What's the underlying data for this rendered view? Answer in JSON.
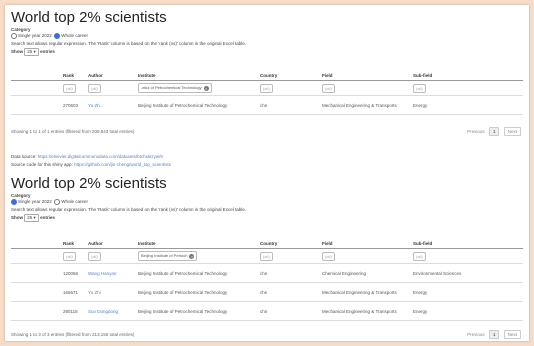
{
  "sec1": {
    "title": "World top 2% scientists",
    "category_label": "Category",
    "options": [
      "Single year 2022",
      "Whole career"
    ],
    "note": "Search text allows regular expression. The 'Rank' column is based on the 'rank (ns)' column in the original Excel table.",
    "show_label": "Show",
    "show_value": "25",
    "entries_label": "entries",
    "headers": [
      "Rank",
      "Author",
      "Institute",
      "Country",
      "Field",
      "Sub-field"
    ],
    "filters": [
      "(all)",
      "(all)",
      "-ekiz of Petrochemical Technology",
      "(all)",
      "(all)",
      "(all)"
    ],
    "rows": [
      {
        "rank": "270603",
        "author": "Yu Zh...",
        "institute": "Beijing Institute of Petrochemical Technology",
        "country": "chn",
        "field": "Mechanical Engineering & Transports",
        "subfield": "Energy"
      }
    ],
    "info": "Showing 1 to 1 of 1 entries (filtered from 209,843 total entries)",
    "prev": "Previous",
    "page": "1",
    "next": "Next"
  },
  "sources": {
    "data_label": "Data source:",
    "data_url": "https://elsevier.digitalcommonsdata.com/datasets/btchxktzyw/6",
    "code_label": "Source code for this shiny app:",
    "code_url": "https://github.com/jin-cheng/world_top_scientists"
  },
  "sec2": {
    "title": "World top 2% scientists",
    "category_label": "Category",
    "options": [
      "Single year 2022",
      "Whole career"
    ],
    "note": "Search text allows regular expression. The 'Rank' column is based on the 'rank (ns)' column in the original Excel table.",
    "show_label": "Show",
    "show_value": "25",
    "entries_label": "entries",
    "headers": [
      "Rank",
      "Author",
      "Institute",
      "Country",
      "Field",
      "Sub-field"
    ],
    "filters": [
      "(all)",
      "(all)",
      "Beijing Institute of Petroch",
      "(all)",
      "(all)",
      "(all)"
    ],
    "rows": [
      {
        "rank": "120056",
        "author": "Wang Hanyan",
        "institute": "Beijing Institute of Petrochemical Technology",
        "country": "chn",
        "field": "Chemical Engineering",
        "subfield": "Environmental Sciences"
      },
      {
        "rank": "165671",
        "author": "Yu Zhi",
        "institute": "Beijing Institute of Petrochemical Technology",
        "country": "chn",
        "field": "Mechanical Engineering & Transports",
        "subfield": "Energy"
      },
      {
        "rank": "280118",
        "author": "Sun Dongdong",
        "institute": "Beijing Institute of Petrochemical Technology",
        "country": "chn",
        "field": "Mechanical Engineering & Transports",
        "subfield": "Energy"
      }
    ],
    "info": "Showing 1 to 3 of 3 entries (filtered from 213,156 total entries)",
    "prev": "Previous",
    "page": "1",
    "next": "Next"
  },
  "colors": {
    "background": "#f7dcc8",
    "link": "#5a83c9",
    "radio_active": "#3a6fd8"
  }
}
